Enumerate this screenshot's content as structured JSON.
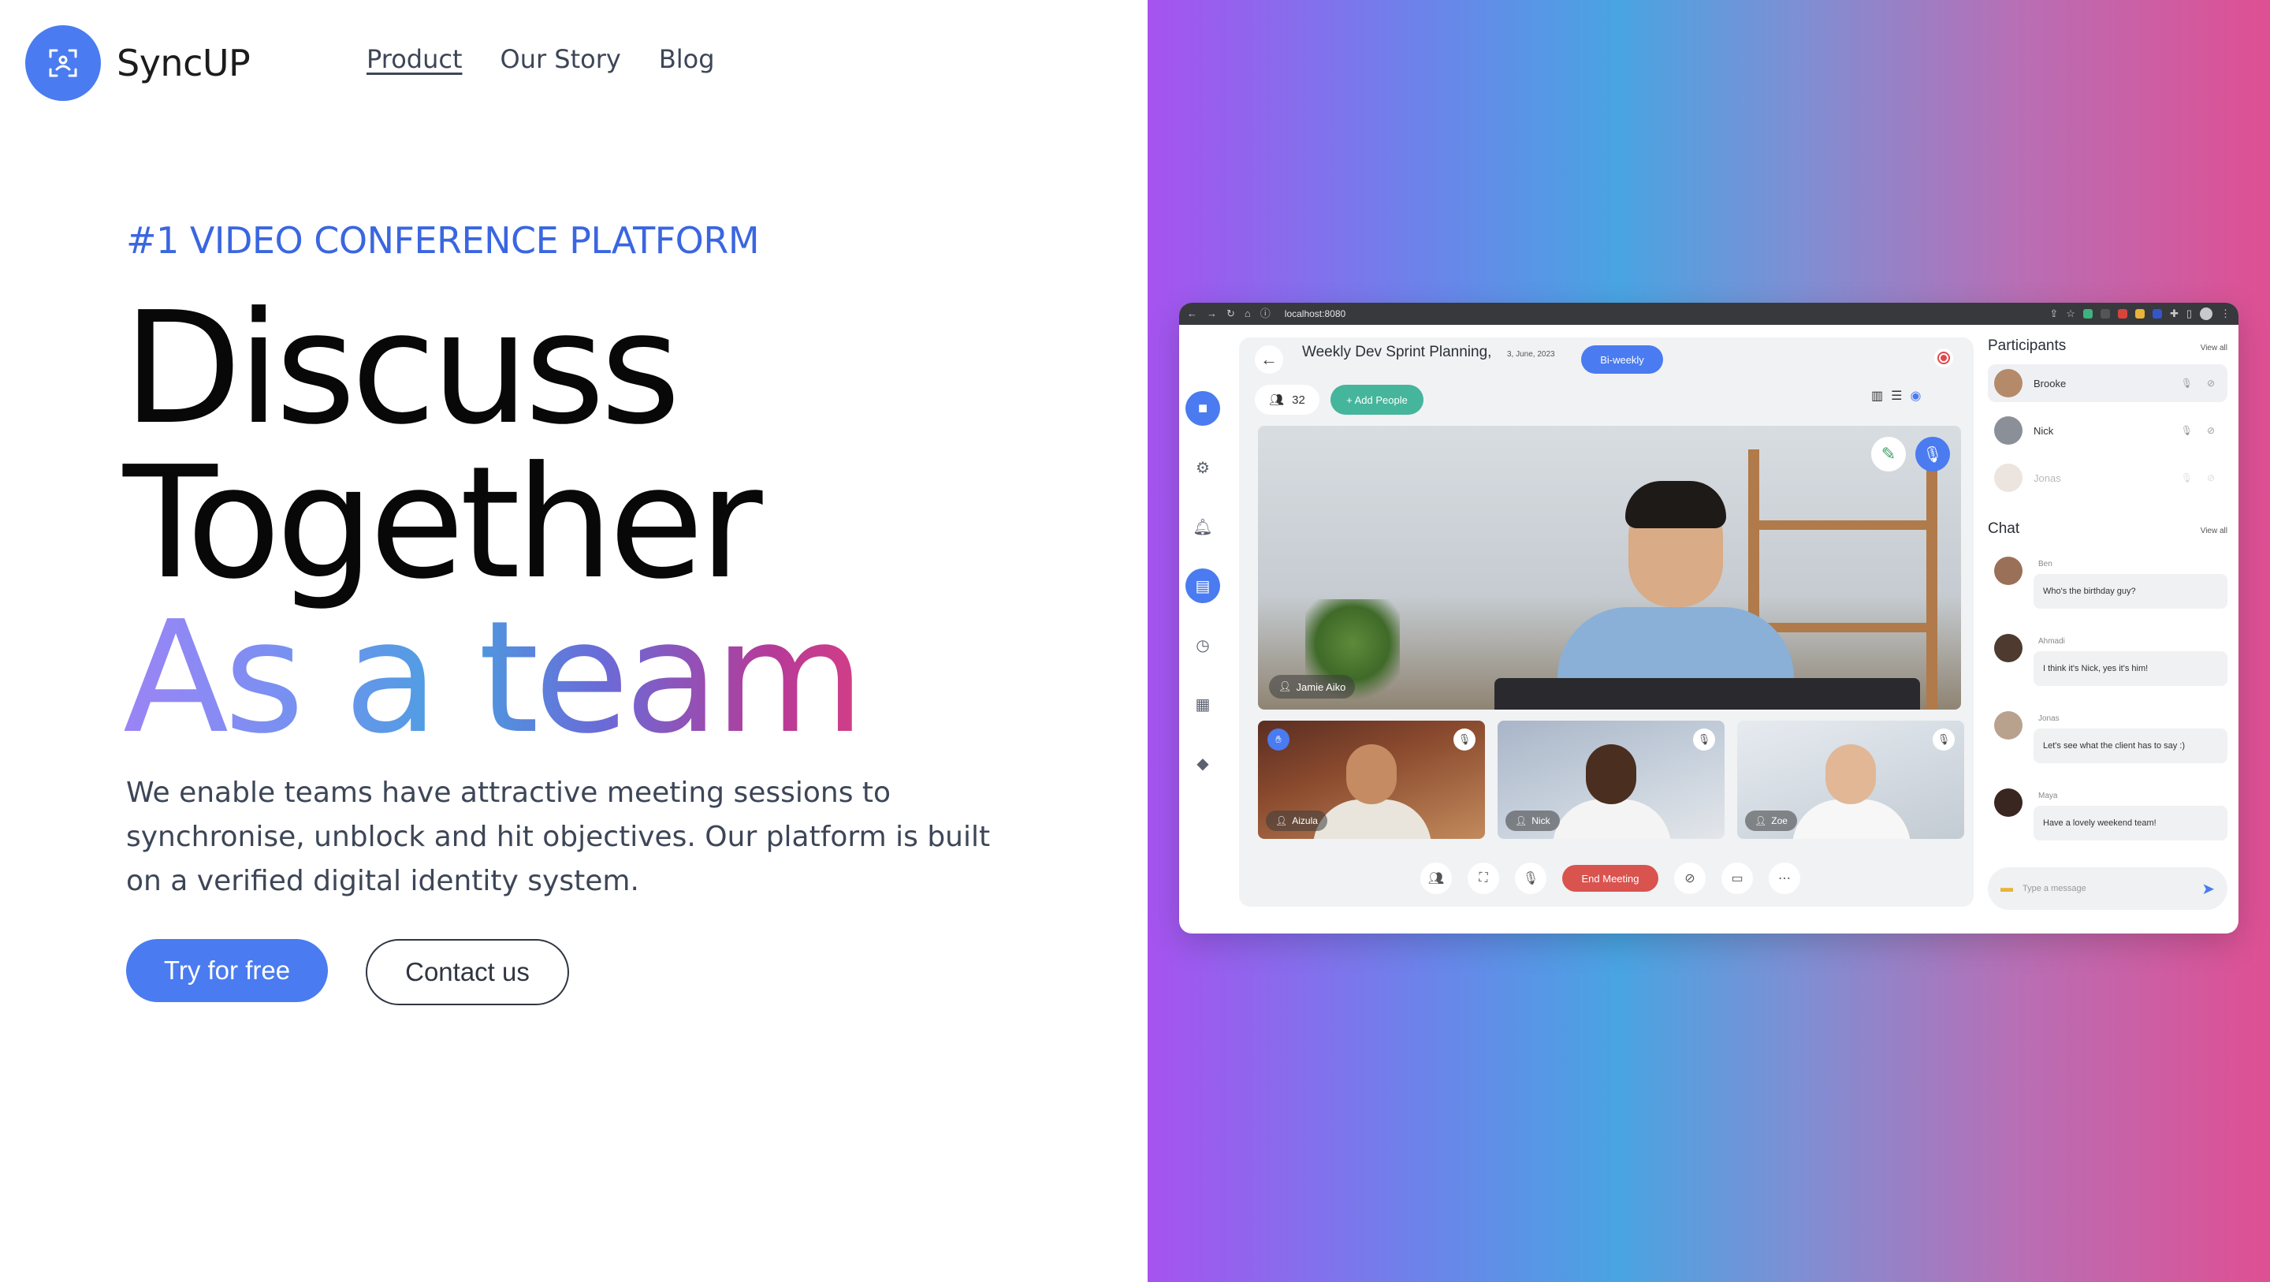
{
  "brand": {
    "name": "SyncUP"
  },
  "nav": [
    "Product",
    "Our Story",
    "Blog"
  ],
  "hero": {
    "eyebrow": "#1 VIDEO CONFERENCE PLATFORM",
    "line1": "Discuss",
    "line2": "Together",
    "line3": "As a team",
    "lead": "We enable teams have attractive meeting sessions to synchronise, unblock and hit objectives. Our platform is built on a verified digital identity system.",
    "cta_primary": "Try for free",
    "cta_secondary": "Contact us"
  },
  "colors": {
    "accent": "#4a7bf0",
    "end_meeting": "#d9534f",
    "add_people": "#45b59c"
  },
  "mockup": {
    "url": "localhost:8080",
    "meeting_title": "Weekly Dev Sprint Planning,",
    "meeting_date": "3, June, 2023",
    "recurrence": "Bi-weekly",
    "participant_count": "32",
    "add_people": "+ Add People",
    "main_speaker": "Jamie Aiko",
    "thumbnails": [
      "Aizula",
      "Nick",
      "Zoe"
    ],
    "end_meeting": "End Meeting",
    "participants_title": "Participants",
    "view_all": "View all",
    "participants": [
      "Brooke",
      "Nick",
      "Jonas"
    ],
    "chat_title": "Chat",
    "chat": [
      {
        "from": "Ben",
        "text": "Who's the birthday guy?"
      },
      {
        "from": "Ahmadi",
        "text": "I think it's Nick, yes it's him!"
      },
      {
        "from": "Jonas",
        "text": "Let's see what the client has to say :)"
      },
      {
        "from": "Maya",
        "text": "Have a lovely weekend team!"
      }
    ],
    "message_placeholder": "Type a message"
  }
}
